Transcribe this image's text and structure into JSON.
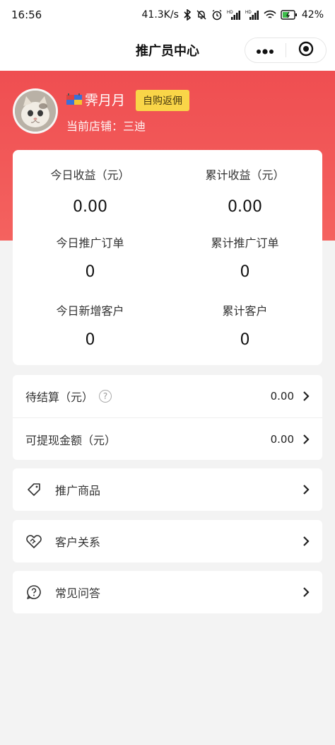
{
  "status_bar": {
    "time": "16:56",
    "net_speed": "41.3K/s",
    "signal_1": "HD",
    "signal_2": "HD",
    "battery": "42%"
  },
  "nav": {
    "title": "推广员中心"
  },
  "user": {
    "name": "霁月月",
    "self_buy_label": "自购返佣",
    "store": "当前店铺：三迪"
  },
  "stats": {
    "today_income_label": "今日收益（元）",
    "today_income_value": "0.00",
    "total_income_label": "累计收益（元）",
    "total_income_value": "0.00",
    "today_orders_label": "今日推广订单",
    "today_orders_value": "0",
    "total_orders_label": "累计推广订单",
    "total_orders_value": "0",
    "today_customers_label": "今日新增客户",
    "today_customers_value": "0",
    "total_customers_label": "累计客户",
    "total_customers_value": "0"
  },
  "balance": {
    "pending_label": "待结算（元）",
    "pending_help": "?",
    "pending_value": "0.00",
    "withdrawable_label": "可提现金额（元）",
    "withdrawable_value": "0.00"
  },
  "menu": {
    "promote_goods": "推广商品",
    "customers": "客户关系",
    "faq": "常见问答"
  },
  "colors": {
    "hero": "#ef4e51",
    "badge": "#f9d548"
  }
}
